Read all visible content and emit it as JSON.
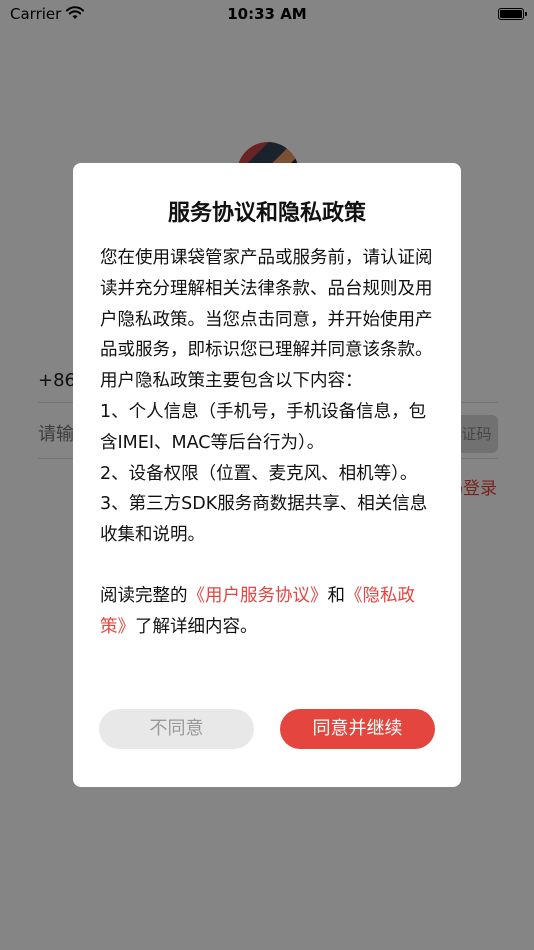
{
  "status_bar": {
    "carrier": "Carrier",
    "time": "10:33 AM"
  },
  "login": {
    "country_code": "+86",
    "code_placeholder": "请输入验证码",
    "get_code_label": "获取验证码",
    "password_login_label": "密码登录"
  },
  "dialog": {
    "title": "服务协议和隐私政策",
    "paragraph1": "您在使用课袋管家产品或服务前，请认证阅读并充分理解相关法律条款、品台规则及用户隐私政策。当您点击同意，并开始使用产品或服务，即标识您已理解并同意该条款。",
    "list_intro": "用户隐私政策主要包含以下内容：",
    "item1": "1、个人信息（手机号，手机设备信息，包含IMEI、MAC等后台行为）。",
    "item2": "2、设备权限（位置、麦克风、相机等）。",
    "item3": "3、第三方SDK服务商数据共享、相关信息收集和说明。",
    "read_prefix": "阅读完整的",
    "user_agreement_link": "《用户服务协议》",
    "and_text": "和",
    "privacy_link": "《隐私政策》",
    "read_suffix": "了解详细内容。",
    "disagree_label": "不同意",
    "agree_label": "同意并继续"
  },
  "colors": {
    "accent": "#e4453f",
    "overlay": "rgba(0,0,0,0.48)"
  }
}
